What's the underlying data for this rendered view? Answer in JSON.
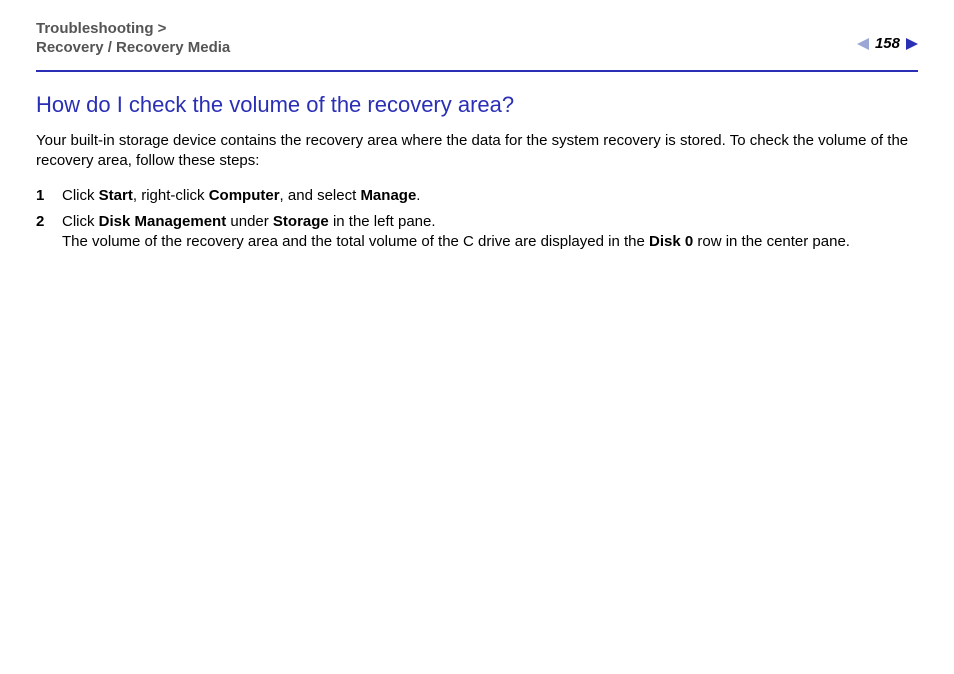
{
  "header": {
    "breadcrumb_line1": "Troubleshooting >",
    "breadcrumb_line2": "Recovery / Recovery Media",
    "page_number": "158"
  },
  "content": {
    "title": "How do I check the volume of the recovery area?",
    "intro": "Your built-in storage device contains the recovery area where the data for the system recovery is stored. To check the volume of the recovery area, follow these steps:",
    "steps": [
      {
        "parts": [
          {
            "t": "Click ",
            "b": false
          },
          {
            "t": "Start",
            "b": true
          },
          {
            "t": ", right-click ",
            "b": false
          },
          {
            "t": "Computer",
            "b": true
          },
          {
            "t": ", and select ",
            "b": false
          },
          {
            "t": "Manage",
            "b": true
          },
          {
            "t": ".",
            "b": false
          }
        ]
      },
      {
        "parts": [
          {
            "t": "Click ",
            "b": false
          },
          {
            "t": "Disk Management",
            "b": true
          },
          {
            "t": " under ",
            "b": false
          },
          {
            "t": "Storage",
            "b": true
          },
          {
            "t": " in the left pane.",
            "b": false
          }
        ],
        "sub_parts": [
          {
            "t": "The volume of the recovery area and the total volume of the C drive are displayed in the ",
            "b": false
          },
          {
            "t": "Disk 0",
            "b": true
          },
          {
            "t": " row in the center pane.",
            "b": false
          }
        ]
      }
    ]
  }
}
